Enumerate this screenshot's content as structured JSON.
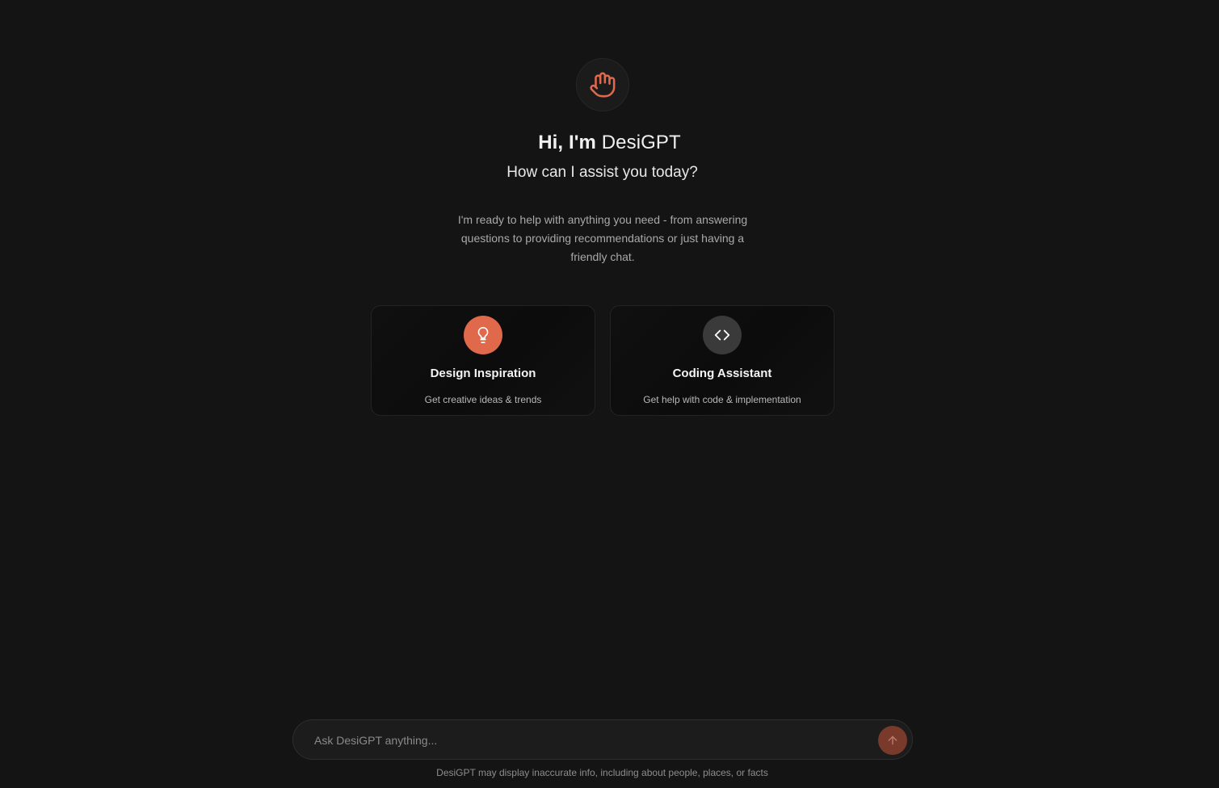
{
  "hero": {
    "icon": "hand-icon",
    "title_prefix": "Hi, I'm ",
    "title_name": "DesiGPT",
    "subtitle": "How can I assist you today?",
    "intro": "I'm ready to help with anything you need - from answering questions to providing recommendations or just having a friendly chat."
  },
  "cards": [
    {
      "icon": "lightbulb-icon",
      "title": "Design Inspiration",
      "description": "Get creative ideas & trends"
    },
    {
      "icon": "code-icon",
      "title": "Coding Assistant",
      "description": "Get help with code & implementation"
    }
  ],
  "composer": {
    "placeholder": "Ask DesiGPT anything...",
    "value": "",
    "send_icon": "arrow-up-icon"
  },
  "disclaimer": "DesiGPT may display inaccurate info, including about people, places, or facts",
  "colors": {
    "background": "#141414",
    "accent": "#e0694c",
    "send_button": "#7a3a2b",
    "code_icon_bg": "#3a3a3a"
  }
}
